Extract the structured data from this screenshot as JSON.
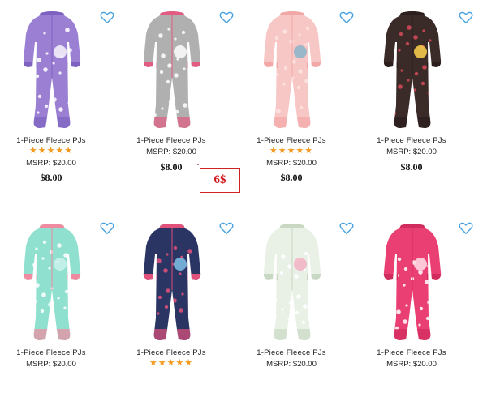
{
  "colors": {
    "heart": "#4aa3e0",
    "star": "#f39a1e",
    "promo": "#d0161b"
  },
  "promo_label": "6$",
  "products": [
    {
      "title": "1-Piece Fleece PJs",
      "rating_stars": 5,
      "msrp": "MSRP: $20.00",
      "price": "$8.00",
      "colors": {
        "body": "#9b7fd3",
        "accent": "#ffffff",
        "trim": "#7e62c0",
        "face": "#f2eef8"
      }
    },
    {
      "title": "1-Piece Fleece PJs",
      "rating_stars": 0,
      "msrp": "MSRP: $20.00",
      "price": "$8.00",
      "colors": {
        "body": "#b0b0b0",
        "accent": "#ffffff",
        "trim": "#e25b80",
        "face": "#fafafa"
      }
    },
    {
      "title": "1-Piece Fleece PJs",
      "rating_stars": 5,
      "msrp": "MSRP: $20.00",
      "price": "$8.00",
      "colors": {
        "body": "#f7c7c5",
        "accent": "#fbe4e2",
        "trim": "#f2a8a6",
        "face": "#8fb5c9"
      }
    },
    {
      "title": "1-Piece Fleece PJs",
      "rating_stars": 0,
      "msrp": "MSRP: $20.00",
      "price": "$8.00",
      "colors": {
        "body": "#3a2a28",
        "accent": "#d84a5b",
        "trim": "#2b1e1c",
        "face": "#f3c94b"
      }
    },
    {
      "title": "1-Piece Fleece PJs",
      "rating_stars": 0,
      "msrp": "MSRP: $20.00",
      "price": "",
      "colors": {
        "body": "#8fe0cf",
        "accent": "#ffffff",
        "trim": "#f08aa0",
        "face": "#c8f2ea"
      }
    },
    {
      "title": "1-Piece Fleece PJs",
      "rating_stars": 5,
      "msrp": "",
      "price": "",
      "colors": {
        "body": "#2a3564",
        "accent": "#e2517a",
        "trim": "#e2517a",
        "face": "#7ab8e0"
      }
    },
    {
      "title": "1-Piece Fleece PJs",
      "rating_stars": 0,
      "msrp": "MSRP: $20.00",
      "price": "",
      "colors": {
        "body": "#e9f0e6",
        "accent": "#ffffff",
        "trim": "#c9d8c2",
        "face": "#f3b5c5"
      }
    },
    {
      "title": "1-Piece Fleece PJs",
      "rating_stars": 0,
      "msrp": "MSRP: $20.00",
      "price": "",
      "colors": {
        "body": "#ea3f72",
        "accent": "#ffffff",
        "trim": "#d02d5e",
        "face": "#ffd6e2"
      }
    }
  ]
}
